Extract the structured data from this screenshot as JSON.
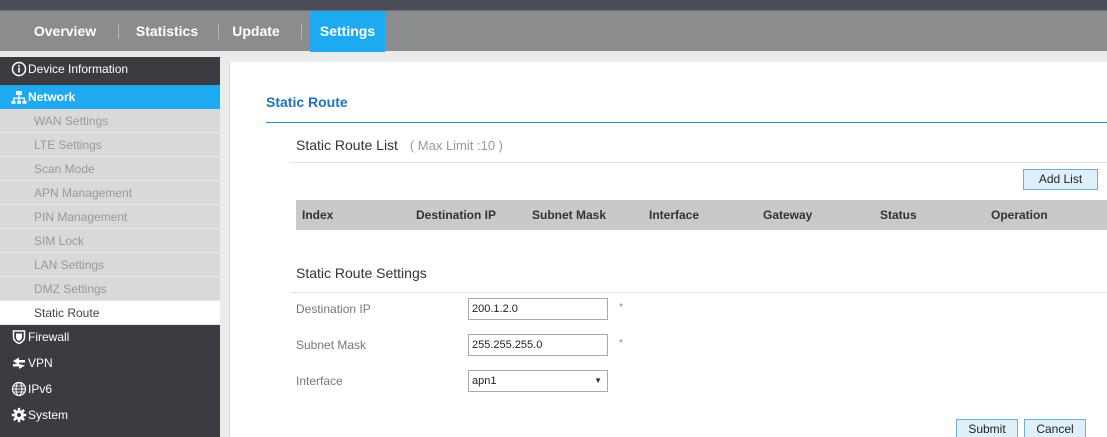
{
  "nav": {
    "tabs": [
      {
        "label": "Overview"
      },
      {
        "label": "Statistics"
      },
      {
        "label": "Update"
      },
      {
        "label": "Settings",
        "active": true
      }
    ]
  },
  "sidebar": {
    "device_information": "Device Information",
    "network": "Network",
    "network_items": [
      "WAN Settings",
      "LTE Settings",
      "Scan Mode",
      "APN Management",
      "PIN Management",
      "SIM Lock",
      "LAN Settings",
      "DMZ Settings",
      "Static Route"
    ],
    "firewall": "Firewall",
    "vpn": "VPN",
    "ipv6": "IPv6",
    "system": "System"
  },
  "main": {
    "title": "Static Route",
    "list_title": "Static Route List",
    "list_limit": "( Max Limit :10 )",
    "add_button": "Add List",
    "table_headers": [
      "Index",
      "Destination IP",
      "Subnet Mask",
      "Interface",
      "Gateway",
      "Status",
      "Operation"
    ],
    "settings_title": "Static Route Settings",
    "form": {
      "destination_ip_label": "Destination IP",
      "destination_ip_value": "200.1.2.0",
      "subnet_mask_label": "Subnet Mask",
      "subnet_mask_value": "255.255.255.0",
      "interface_label": "Interface",
      "interface_value": "apn1",
      "required_mark": "*"
    },
    "submit_button": "Submit",
    "cancel_button": "Cancel"
  },
  "colors": {
    "accent": "#1eaaf1",
    "title_blue": "#1e73be",
    "sidebar_bg": "#3a3c41",
    "nav_bg": "#8b8c8e"
  }
}
